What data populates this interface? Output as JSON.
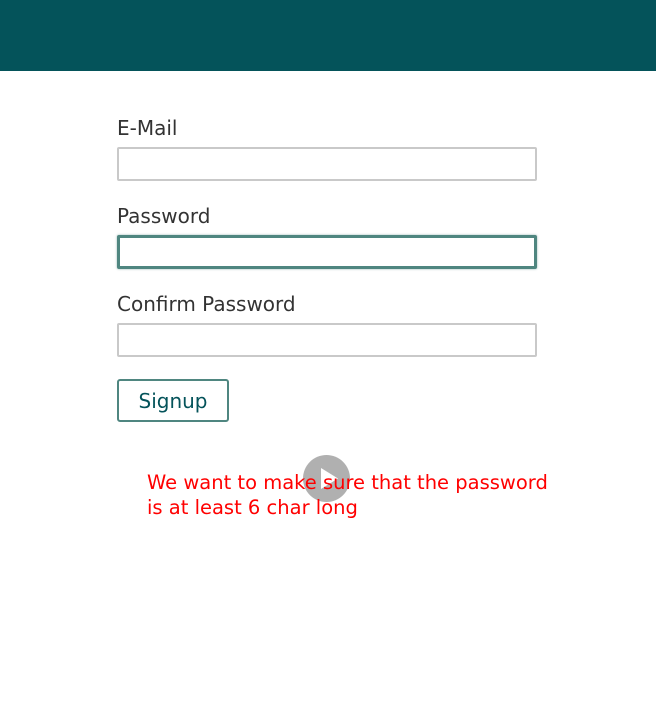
{
  "header": {
    "color": "#04535a"
  },
  "form": {
    "email": {
      "label": "E-Mail",
      "value": ""
    },
    "password": {
      "label": "Password",
      "value": "",
      "focused": true
    },
    "confirm_password": {
      "label": "Confirm Password",
      "value": ""
    },
    "signup_label": "Signup",
    "accent_color": "#4f8680"
  },
  "video": {
    "play_icon": "play-icon"
  },
  "annotation": {
    "text": "We want to make sure that the password\nis at least 6 char long",
    "color": "#ff0000"
  }
}
